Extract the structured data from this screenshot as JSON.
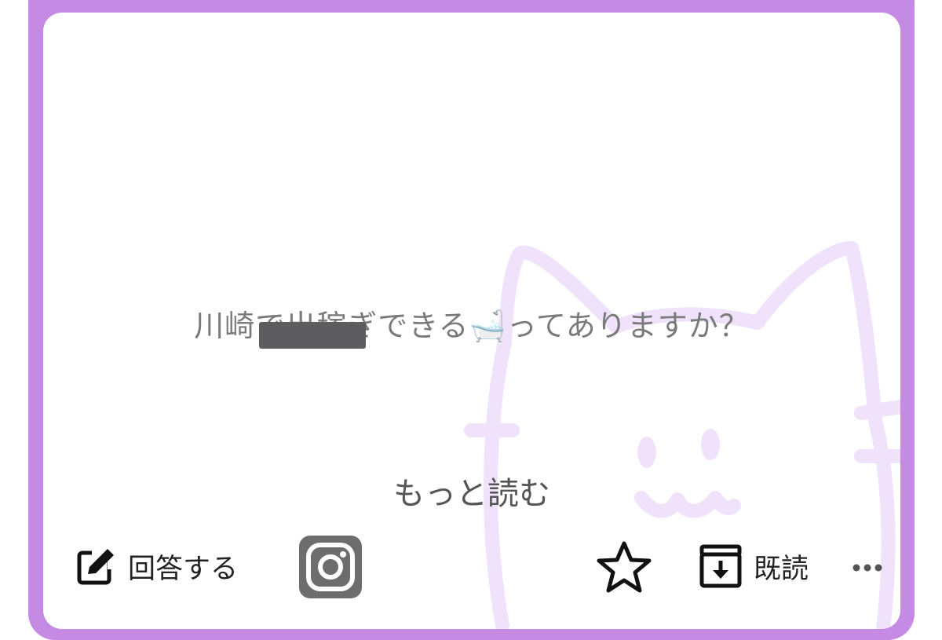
{
  "card": {
    "question": "川崎で出稼ぎできる🛁ってありますか？",
    "read_more_label": "もっと読む"
  },
  "actions": {
    "answer_label": "回答する",
    "instagram_icon": "instagram-icon",
    "star_icon": "star-icon",
    "archive_label": "既読",
    "more_icon": "more-horizontal-icon"
  },
  "theme": {
    "frame_color": "#c58ae3",
    "watermark_color": "#efe2fa",
    "text_color": "#7a7a7a"
  }
}
